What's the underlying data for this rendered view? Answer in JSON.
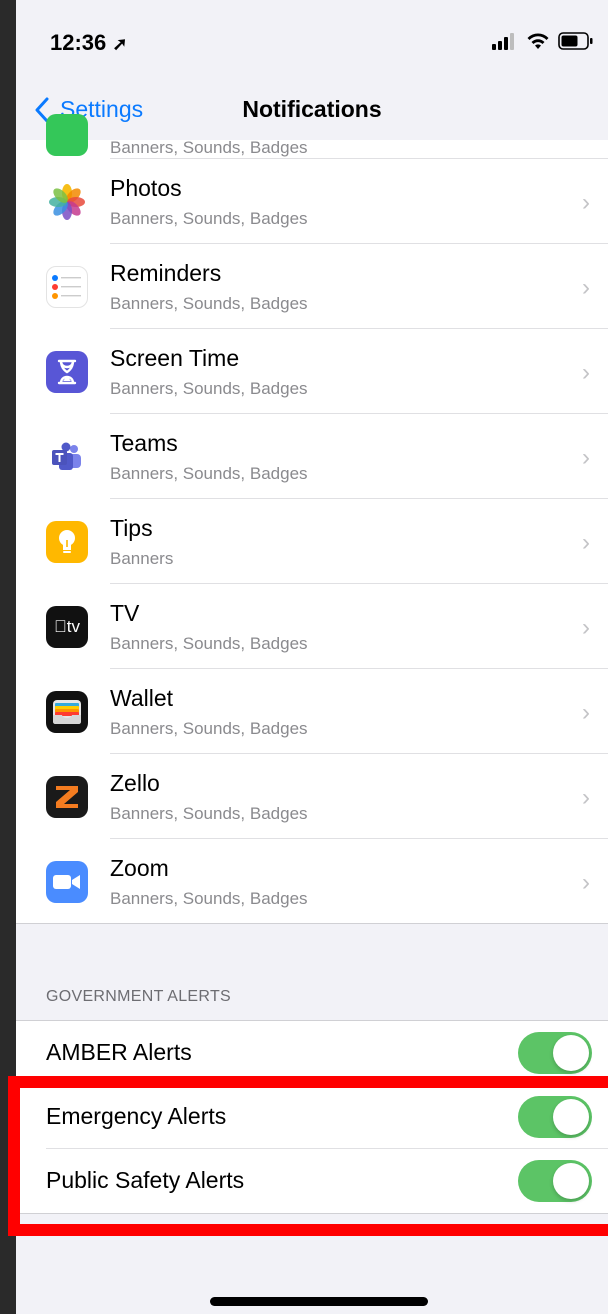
{
  "status": {
    "time": "12:36"
  },
  "nav": {
    "back_label": "Settings",
    "title": "Notifications"
  },
  "apps": [
    {
      "name": "",
      "subtitle": "Banners, Sounds, Badges",
      "icon": "messages-icon"
    },
    {
      "name": "Photos",
      "subtitle": "Banners, Sounds, Badges",
      "icon": "photos-icon"
    },
    {
      "name": "Reminders",
      "subtitle": "Banners, Sounds, Badges",
      "icon": "reminders-icon"
    },
    {
      "name": "Screen Time",
      "subtitle": "Banners, Sounds, Badges",
      "icon": "screen-time-icon"
    },
    {
      "name": "Teams",
      "subtitle": "Banners, Sounds, Badges",
      "icon": "teams-icon"
    },
    {
      "name": "Tips",
      "subtitle": "Banners",
      "icon": "tips-icon"
    },
    {
      "name": "TV",
      "subtitle": "Banners, Sounds, Badges",
      "icon": "tv-icon"
    },
    {
      "name": "Wallet",
      "subtitle": "Banners, Sounds, Badges",
      "icon": "wallet-icon"
    },
    {
      "name": "Zello",
      "subtitle": "Banners, Sounds, Badges",
      "icon": "zello-icon"
    },
    {
      "name": "Zoom",
      "subtitle": "Banners, Sounds, Badges",
      "icon": "zoom-icon"
    }
  ],
  "government_alerts": {
    "header": "GOVERNMENT ALERTS",
    "items": [
      {
        "label": "AMBER Alerts",
        "enabled": true
      },
      {
        "label": "Emergency Alerts",
        "enabled": true
      },
      {
        "label": "Public Safety Alerts",
        "enabled": true
      }
    ]
  },
  "colors": {
    "accent": "#0a7aff",
    "toggle_on": "#5cc466",
    "highlight": "#ff0000"
  },
  "tv_icon_text": "tv"
}
